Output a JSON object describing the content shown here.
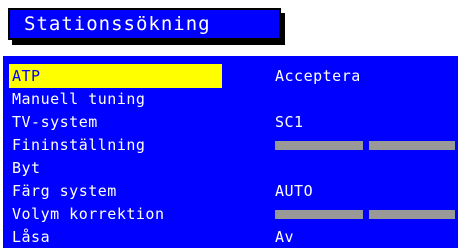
{
  "title": "Stationssökning",
  "menu": {
    "items": [
      {
        "label": "ATP",
        "value": "Acceptera",
        "selected": true
      },
      {
        "label": "Manuell tuning",
        "value": ""
      },
      {
        "label": "TV-system",
        "value": "SC1"
      },
      {
        "label": "Fininställning",
        "value": "",
        "slider": true
      },
      {
        "label": "Byt",
        "value": ""
      },
      {
        "label": "Färg system",
        "value": "AUTO"
      },
      {
        "label": "Volym korrektion",
        "value": "",
        "slider": true
      },
      {
        "label": "Låsa",
        "value": "Av"
      }
    ]
  },
  "colors": {
    "background": "#0000ff",
    "highlight": "#ffff00",
    "text": "#ffffff",
    "slider": "#999999"
  }
}
